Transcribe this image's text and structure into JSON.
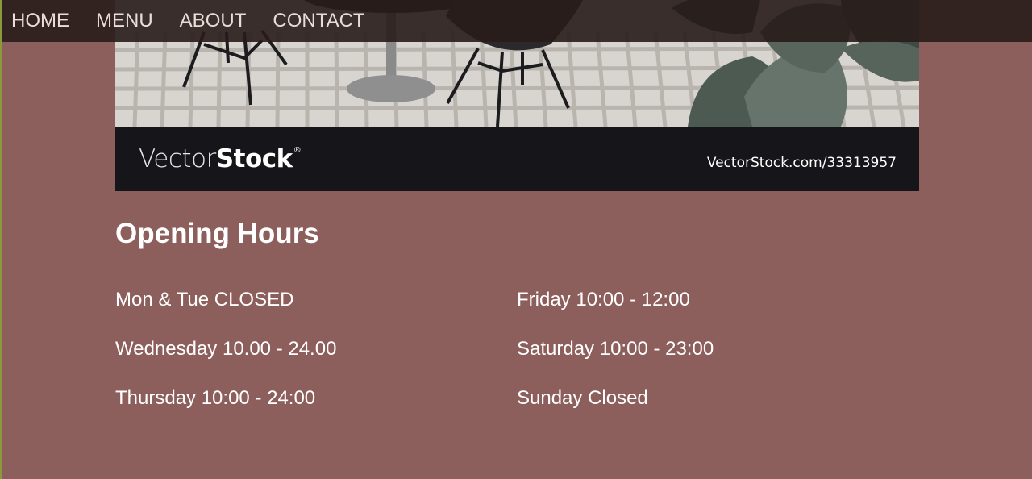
{
  "nav": {
    "items": [
      {
        "label": "HOME"
      },
      {
        "label": "MENU"
      },
      {
        "label": "ABOUT"
      },
      {
        "label": "CONTACT"
      }
    ]
  },
  "hero": {
    "watermark_brand_light": "Vector",
    "watermark_brand_bold": "Stock",
    "watermark_registered": "®",
    "watermark_url": "VectorStock.com/33313957"
  },
  "opening_hours": {
    "title": "Opening Hours",
    "left": [
      "Mon & Tue CLOSED",
      "Wednesday 10.00 - 24.00",
      "Thursday 10:00 - 24:00"
    ],
    "right": [
      "Friday 10:00 - 12:00",
      "Saturday 10:00 - 23:00",
      "Sunday Closed"
    ]
  },
  "colors": {
    "page_background": "#8d5f5c",
    "nav_background": "#281c1a",
    "text": "#ffffff"
  }
}
